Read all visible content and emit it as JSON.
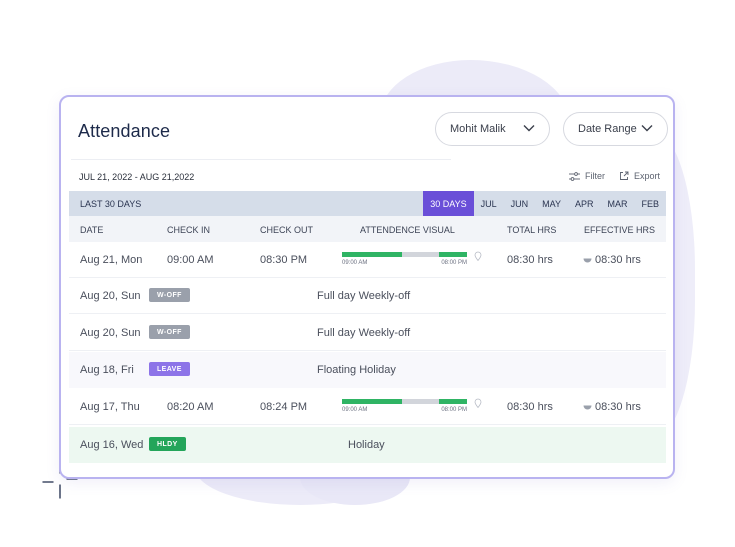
{
  "title": "Attendance",
  "user_filter": "Mohit Malik",
  "date_filter": "Date Range",
  "date_range": "JUL 21, 2022 - AUG 21,2022",
  "actions": {
    "filter": "Filter",
    "export": "Export"
  },
  "period_label": "LAST 30 DAYS",
  "tabs": [
    "30 DAYS",
    "JUL",
    "JUN",
    "MAY",
    "APR",
    "MAR",
    "FEB"
  ],
  "active_tab": "30 DAYS",
  "columns": {
    "date": "DATE",
    "check_in": "CHECK IN",
    "check_out": "CHECK OUT",
    "visual": "ATTENDENCE VISUAL",
    "total": "TOTAL HRS",
    "effective": "EFFECTIVE HRS"
  },
  "visual_start": "09:00 AM",
  "visual_end": "08:00 PM",
  "rows": [
    {
      "date": "Aug 21, Mon",
      "check_in": "09:00 AM",
      "check_out": "08:30 PM",
      "total": "08:30 hrs",
      "effective": "08:30 hrs"
    },
    {
      "date": "Aug 20, Sun",
      "badge": "W-OFF",
      "note": "Full day Weekly-off"
    },
    {
      "date": "Aug 20, Sun",
      "badge": "W-OFF",
      "note": "Full day Weekly-off"
    },
    {
      "date": "Aug 18, Fri",
      "badge": "LEAVE",
      "note": "Floating Holiday"
    },
    {
      "date": "Aug 17, Thu",
      "check_in": "08:20 AM",
      "check_out": "08:24 PM",
      "total": "08:30 hrs",
      "effective": "08:30 hrs"
    },
    {
      "date": "Aug 16, Wed",
      "badge": "HLDY",
      "note": "Holiday"
    }
  ],
  "colors": {
    "accent": "#6a4fd8",
    "present_bar": "#2fb464",
    "woff_badge": "#9aa0ab",
    "leave_badge": "#8d74e8",
    "holiday_badge": "#23a55a",
    "card_border": "#b9b3f0"
  },
  "icons": {
    "filter": "sliders-icon",
    "export": "export-icon",
    "dropdown": "chevron-down-icon",
    "location": "location-pin-icon",
    "effective": "half-circle-icon"
  }
}
